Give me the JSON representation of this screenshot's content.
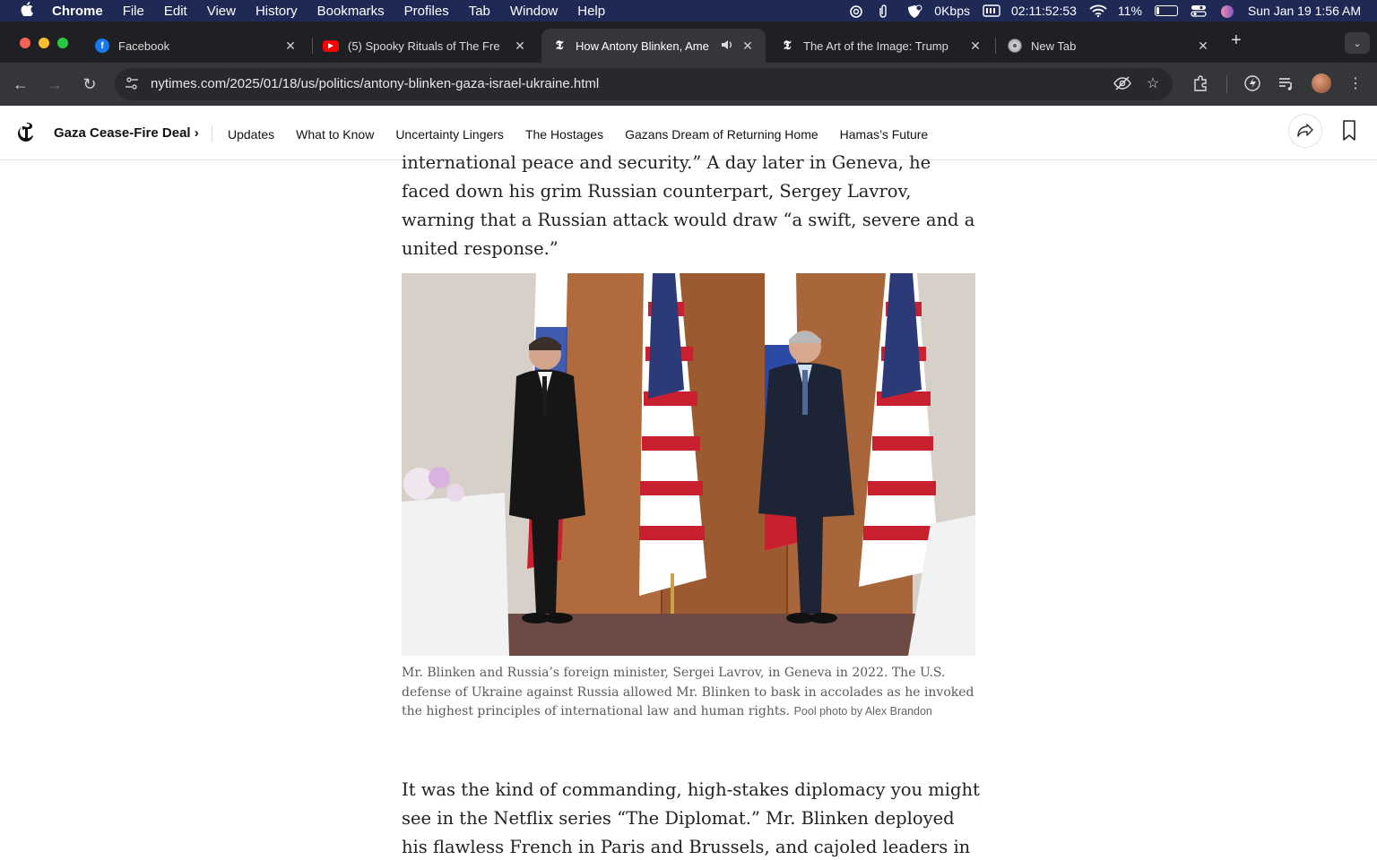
{
  "menubar": {
    "app": "Chrome",
    "items": [
      "File",
      "Edit",
      "View",
      "History",
      "Bookmarks",
      "Profiles",
      "Tab",
      "Window",
      "Help"
    ],
    "network": "0Kbps",
    "timer": "02:11:52:53",
    "battery": "11%",
    "datetime": "Sun Jan 19  1:56 AM"
  },
  "tabs": [
    {
      "title": "Facebook",
      "icon": "facebook-icon",
      "color": "#1877f2"
    },
    {
      "title": "(5) Spooky Rituals of The Fre",
      "icon": "youtube-icon",
      "color": "#ff0000"
    },
    {
      "title": "How Antony Blinken, Ame",
      "icon": "nyt-icon",
      "color": "#ffffff",
      "active": true
    },
    {
      "title": "The Art of the Image: Trump",
      "icon": "nyt-icon",
      "color": "#ffffff"
    },
    {
      "title": "New Tab",
      "icon": "chrome-icon",
      "color": "#bbbbbb"
    }
  ],
  "toolbar": {
    "url": "nytimes.com/2025/01/18/us/politics/antony-blinken-gaza-israel-ukraine.html"
  },
  "nyt_nav": {
    "section": "Gaza Cease-Fire Deal ›",
    "links": [
      "Updates",
      "What to Know",
      "Uncertainty Lingers",
      "The Hostages",
      "Gazans Dream of Returning Home",
      "Hamas’s Future"
    ]
  },
  "article": {
    "para_top": "international peace and security.” A day later in Geneva, he faced down his grim Russian counterpart, Sergey Lavrov, warning that a Russian attack would draw “a swift, severe and a united response.”",
    "caption": "Mr. Blinken and Russia’s foreign minister, Sergei Lavrov, in Geneva in 2022. The U.S. defense of Ukraine against Russia allowed Mr. Blinken to bask in accolades as he invoked the highest principles of international law and human rights.",
    "credit": "Pool photo by Alex Brandon",
    "para_bottom": "It was the kind of commanding, high-stakes diplomacy you might see in the Netflix series “The Diplomat.” Mr. Blinken deployed his flawless French in Paris and Brussels, and cajoled leaders in Seoul"
  }
}
